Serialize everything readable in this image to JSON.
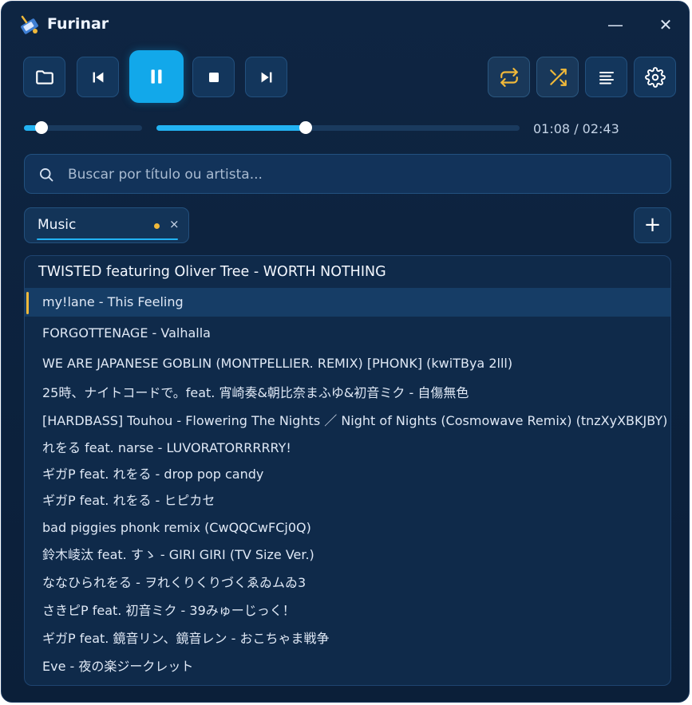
{
  "window": {
    "title": "Furinar",
    "minimize_label": "—",
    "close_label": "✕"
  },
  "toolbar": {
    "buttons": [
      {
        "name": "open-folder",
        "icon": "folder-icon"
      },
      {
        "name": "previous",
        "icon": "skip-back-icon"
      },
      {
        "name": "pause",
        "icon": "pause-icon",
        "state": "playing"
      },
      {
        "name": "stop",
        "icon": "stop-icon"
      },
      {
        "name": "next",
        "icon": "skip-forward-icon"
      },
      {
        "name": "repeat",
        "icon": "repeat-icon",
        "active": true
      },
      {
        "name": "shuffle",
        "icon": "shuffle-icon",
        "active": true
      },
      {
        "name": "queue",
        "icon": "list-icon"
      },
      {
        "name": "settings",
        "icon": "gear-icon"
      }
    ],
    "accent_color": "#12a8ea",
    "toggle_color": "#f0b93a"
  },
  "player": {
    "volume": 0.15,
    "progress": 0.41,
    "time_display": "01:08 / 02:43"
  },
  "search": {
    "placeholder": "Buscar por título ou artista..."
  },
  "playlists": {
    "tabs": [
      {
        "label": "Music",
        "unsaved": true,
        "close_label": "×"
      }
    ],
    "add_label": "+"
  },
  "tracks": [
    "TWISTED featuring Oliver Tree - WORTH NOTHING",
    "my!lane - This Feeling",
    "FORGOTTENAGE - Valhalla",
    "WE ARE JAPANESE GOBLIN (MONTPELLIER. REMIX) [PHONK] (kwiTBya 2lll)",
    "25時、ナイトコードで。feat. 宵崎奏&朝比奈まふゆ&初音ミク - 自傷無色",
    "[HARDBASS] Touhou - Flowering The Nights ／ Night of Nights (Cosmowave Remix) (tnzXyXBKJBY)",
    "れをる feat. narse - LUVORATORRRRRY!",
    "ギガP feat. れをる - drop pop candy",
    "ギガP feat. れをる - ヒピカセ",
    "bad piggies phonk remix (CwQQCwFCj0Q)",
    "鈴木崚汰 feat. すゝ - GIRI GIRI (TV Size Ver.)",
    "ななひられをる - ヲれくりくりづくゑゐムゐ3",
    "さきピP feat. 初音ミク - 39みゅーじっく！",
    "ギガP feat. 鏡音リン、鏡音レン - おこちゃま戦争",
    "Eve - 夜の楽ジークレット"
  ],
  "active_track_index": 1
}
